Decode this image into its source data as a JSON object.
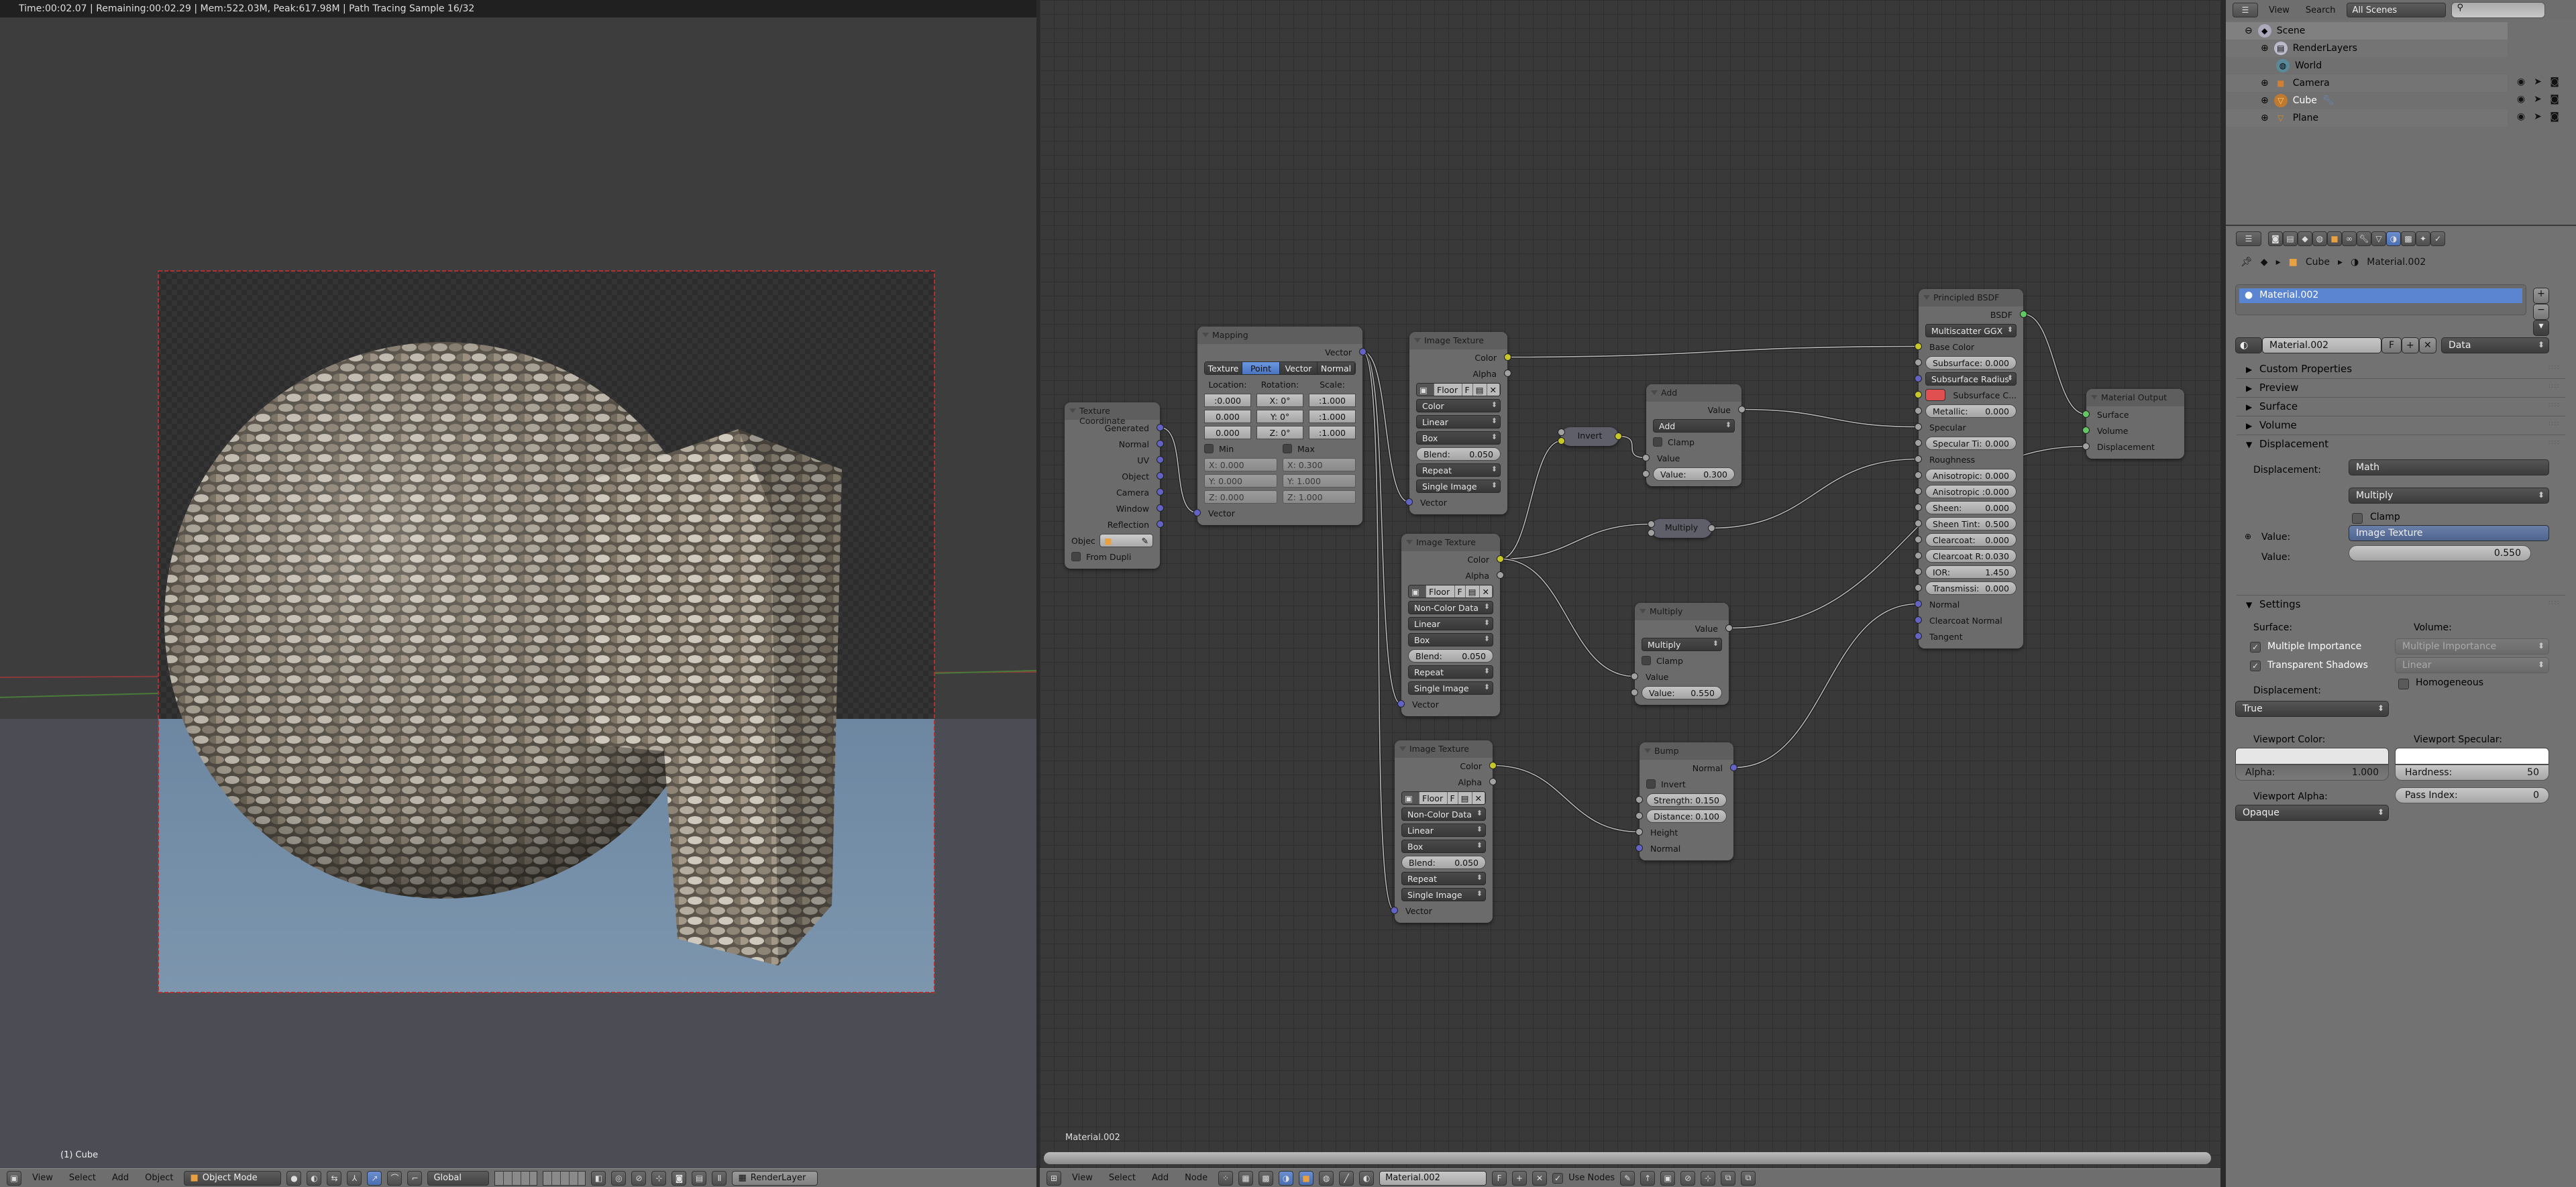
{
  "viewport": {
    "render_info": "Time:00:02.07 | Remaining:00:02.29 | Mem:522.03M, Peak:617.98M | Path Tracing Sample 16/32",
    "object_label": "(1) Cube",
    "header": {
      "menus": [
        "View",
        "Select",
        "Add",
        "Object"
      ],
      "mode": "Object Mode",
      "orientation": "Global",
      "render_layer": "RenderLayer"
    }
  },
  "node_editor": {
    "material_label": "Material.002",
    "header": {
      "menus": [
        "View",
        "Select",
        "Add",
        "Node"
      ],
      "material": "Material.002",
      "fake_user": "F",
      "use_nodes": "Use Nodes"
    },
    "socket_colors": {
      "yellow": "#c7c729",
      "gray": "#a1a1a1",
      "blue": "#6363c7",
      "green": "#63c763"
    },
    "nodes": {
      "texcoord": {
        "title": "Texture Coordinate",
        "rows": [
          {
            "t": "out",
            "label": "Generated",
            "s": "blue"
          },
          {
            "t": "out",
            "label": "Normal",
            "s": "blue"
          },
          {
            "t": "out",
            "label": "UV",
            "s": "blue"
          },
          {
            "t": "out",
            "label": "Object",
            "s": "blue"
          },
          {
            "t": "out",
            "label": "Camera",
            "s": "blue"
          },
          {
            "t": "out",
            "label": "Window",
            "s": "blue"
          },
          {
            "t": "out",
            "label": "Reflection",
            "s": "blue"
          },
          {
            "t": "obj",
            "label": "Objec"
          },
          {
            "t": "chk",
            "label": "From Dupli"
          }
        ]
      },
      "mapping": {
        "title": "Mapping",
        "rows": [
          {
            "t": "out",
            "label": "Vector",
            "s": "blue"
          },
          {
            "t": "tabs",
            "items": [
              "Texture",
              "Point",
              "Vector",
              "Normal"
            ],
            "active": "Point"
          },
          {
            "t": "cols",
            "kind": "label",
            "cells": [
              "Location:",
              "Rotation:",
              "Scale:"
            ]
          },
          {
            "t": "cols",
            "kind": "mini",
            "cells": [
              ":0.000",
              "X:   0°",
              ":1.000"
            ]
          },
          {
            "t": "cols",
            "kind": "mini",
            "cells": [
              "0.000",
              "Y:   0°",
              ":1.000"
            ]
          },
          {
            "t": "cols",
            "kind": "mini",
            "cells": [
              "0.000",
              "Z:   0°",
              ":1.000"
            ]
          },
          {
            "t": "cols",
            "kind": "chk",
            "cells": [
              "Min",
              "Max"
            ]
          },
          {
            "t": "cols",
            "kind": "dis",
            "cells": [
              "X:  0.000",
              "X:  0.300"
            ]
          },
          {
            "t": "cols",
            "kind": "dis",
            "cells": [
              "Y:  0.000",
              "Y:  1.000"
            ]
          },
          {
            "t": "cols",
            "kind": "dis",
            "cells": [
              "Z:  0.000",
              "Z:  1.000"
            ]
          },
          {
            "t": "in",
            "label": "Vector",
            "s": "blue"
          }
        ]
      },
      "img1": {
        "title": "Image Texture",
        "rows": [
          {
            "t": "out",
            "label": "Color",
            "s": "yellow"
          },
          {
            "t": "out",
            "label": "Alpha",
            "s": "gray"
          },
          {
            "t": "img",
            "name": "Floor",
            "f": "F"
          },
          {
            "t": "sel",
            "value": "Color"
          },
          {
            "t": "sel",
            "value": "Linear"
          },
          {
            "t": "sel",
            "value": "Box"
          },
          {
            "t": "num",
            "label": "Blend:",
            "value": "0.050"
          },
          {
            "t": "sel",
            "value": "Repeat"
          },
          {
            "t": "sel",
            "value": "Single Image"
          },
          {
            "t": "in",
            "label": "Vector",
            "s": "blue"
          }
        ]
      },
      "img2": {
        "title": "Image Texture",
        "rows": [
          {
            "t": "out",
            "label": "Color",
            "s": "yellow"
          },
          {
            "t": "out",
            "label": "Alpha",
            "s": "gray"
          },
          {
            "t": "img",
            "name": "Floor",
            "f": "F"
          },
          {
            "t": "sel",
            "value": "Non-Color Data"
          },
          {
            "t": "sel",
            "value": "Linear"
          },
          {
            "t": "sel",
            "value": "Box"
          },
          {
            "t": "num",
            "label": "Blend:",
            "value": "0.050"
          },
          {
            "t": "sel",
            "value": "Repeat"
          },
          {
            "t": "sel",
            "value": "Single Image"
          },
          {
            "t": "in",
            "label": "Vector",
            "s": "blue"
          }
        ]
      },
      "img3": {
        "title": "Image Texture",
        "rows": [
          {
            "t": "out",
            "label": "Color",
            "s": "yellow"
          },
          {
            "t": "out",
            "label": "Alpha",
            "s": "gray"
          },
          {
            "t": "img",
            "name": "Floor",
            "f": "F"
          },
          {
            "t": "sel",
            "value": "Non-Color Data"
          },
          {
            "t": "sel",
            "value": "Linear"
          },
          {
            "t": "sel",
            "value": "Box"
          },
          {
            "t": "num",
            "label": "Blend:",
            "value": "0.050"
          },
          {
            "t": "sel",
            "value": "Repeat"
          },
          {
            "t": "sel",
            "value": "Single Image"
          },
          {
            "t": "in",
            "label": "Vector",
            "s": "blue"
          }
        ]
      },
      "invert": {
        "title": "Invert",
        "collapsed": true,
        "inputs": [
          "gray",
          "yellow"
        ],
        "output": "yellow"
      },
      "mulsmall": {
        "title": "Multiply",
        "collapsed": true,
        "inputs": [
          "gray",
          "gray"
        ],
        "output": "gray"
      },
      "add": {
        "title": "Add",
        "rows": [
          {
            "t": "out",
            "label": "Value",
            "s": "gray"
          },
          {
            "t": "sel",
            "value": "Add"
          },
          {
            "t": "chk",
            "label": "Clamp"
          },
          {
            "t": "in",
            "label": "Value",
            "s": "gray"
          },
          {
            "t": "num",
            "label": "Value:",
            "value": "0.300",
            "s": "gray"
          }
        ]
      },
      "multiply": {
        "title": "Multiply",
        "rows": [
          {
            "t": "out",
            "label": "Value",
            "s": "gray"
          },
          {
            "t": "sel",
            "value": "Multiply"
          },
          {
            "t": "chk",
            "label": "Clamp"
          },
          {
            "t": "in",
            "label": "Value",
            "s": "gray"
          },
          {
            "t": "num",
            "label": "Value:",
            "value": "0.550",
            "s": "gray"
          }
        ]
      },
      "bump": {
        "title": "Bump",
        "rows": [
          {
            "t": "out",
            "label": "Normal",
            "s": "blue"
          },
          {
            "t": "chk",
            "label": "Invert"
          },
          {
            "t": "num",
            "label": "Strength:",
            "value": "0.150",
            "s": "gray"
          },
          {
            "t": "num",
            "label": "Distance:",
            "value": "0.100",
            "s": "gray"
          },
          {
            "t": "in",
            "label": "Height",
            "s": "gray"
          },
          {
            "t": "in",
            "label": "Normal",
            "s": "blue"
          }
        ]
      },
      "principled": {
        "title": "Principled BSDF",
        "rows": [
          {
            "t": "out",
            "label": "BSDF",
            "s": "green"
          },
          {
            "t": "sel",
            "value": "Multiscatter GGX"
          },
          {
            "t": "in",
            "label": "Base Color",
            "s": "yellow"
          },
          {
            "t": "num",
            "label": "Subsurface:",
            "value": "0.000",
            "s": "gray"
          },
          {
            "t": "sel",
            "value": "Subsurface Radius",
            "s": "blue"
          },
          {
            "t": "color",
            "label": "Subsurface C...",
            "s": "yellow",
            "color": "#e05050"
          },
          {
            "t": "num",
            "label": "Metallic:",
            "value": "0.000",
            "s": "gray"
          },
          {
            "t": "in",
            "label": "Specular",
            "s": "gray"
          },
          {
            "t": "num",
            "label": "Specular Ti:",
            "value": "0.000",
            "s": "gray"
          },
          {
            "t": "in",
            "label": "Roughness",
            "s": "gray"
          },
          {
            "t": "num",
            "label": "Anisotropic:",
            "value": "0.000",
            "s": "gray"
          },
          {
            "t": "num",
            "label": "Anisotropic :",
            "value": "0.000",
            "s": "gray"
          },
          {
            "t": "num",
            "label": "Sheen:",
            "value": "0.000",
            "s": "gray"
          },
          {
            "t": "num",
            "label": "Sheen Tint:",
            "value": "0.500",
            "s": "gray"
          },
          {
            "t": "num",
            "label": "Clearcoat:",
            "value": "0.000",
            "s": "gray"
          },
          {
            "t": "num",
            "label": "Clearcoat R:",
            "value": "0.030",
            "s": "gray"
          },
          {
            "t": "num",
            "label": "IOR:",
            "value": "1.450",
            "s": "gray"
          },
          {
            "t": "num",
            "label": "Transmissi:",
            "value": "0.000",
            "s": "gray"
          },
          {
            "t": "in",
            "label": "Normal",
            "s": "blue"
          },
          {
            "t": "in",
            "label": "Clearcoat Normal",
            "s": "blue"
          },
          {
            "t": "in",
            "label": "Tangent",
            "s": "blue"
          }
        ]
      },
      "output": {
        "title": "Material Output",
        "rows": [
          {
            "t": "in",
            "label": "Surface",
            "s": "green"
          },
          {
            "t": "in",
            "label": "Volume",
            "s": "green"
          },
          {
            "t": "in",
            "label": "Displacement",
            "s": "gray"
          }
        ]
      }
    },
    "links": [
      [
        "texcoord",
        "o0",
        "mapping",
        "i0"
      ],
      [
        "mapping",
        "o0",
        "img1",
        "i0"
      ],
      [
        "mapping",
        "o0",
        "img2",
        "i0"
      ],
      [
        "mapping",
        "o0",
        "img3",
        "i0"
      ],
      [
        "img1",
        "o0",
        "principled",
        "i0"
      ],
      [
        "img2",
        "o0",
        "invert",
        "i1"
      ],
      [
        "img2",
        "o0",
        "mulsmall",
        "i0"
      ],
      [
        "img2",
        "o0",
        "multiply",
        "i0"
      ],
      [
        "invert",
        "o0",
        "add",
        "i0"
      ],
      [
        "add",
        "o0",
        "principled",
        "i5"
      ],
      [
        "mulsmall",
        "o0",
        "principled",
        "i7"
      ],
      [
        "multiply",
        "o0",
        "output",
        "i2"
      ],
      [
        "img3",
        "o0",
        "bump",
        "i2"
      ],
      [
        "bump",
        "o0",
        "principled",
        "i16"
      ],
      [
        "principled",
        "o0",
        "output",
        "i0"
      ]
    ]
  },
  "outliner": {
    "menus": [
      "View",
      "Search"
    ],
    "scene_filter": "All Scenes",
    "items": [
      {
        "label": "Scene"
      },
      {
        "label": "RenderLayers"
      },
      {
        "label": "World"
      },
      {
        "label": "Camera"
      },
      {
        "label": "Cube"
      },
      {
        "label": "Plane"
      }
    ]
  },
  "properties": {
    "breadcrumb": [
      "Cube",
      "Material.002"
    ],
    "slot": "Material.002",
    "material_name": "Material.002",
    "fake_user": "F",
    "link": "Data",
    "panels": [
      "Custom Properties",
      "Preview",
      "Surface",
      "Volume",
      "Displacement",
      "Settings"
    ],
    "displacement": {
      "label": "Displacement:",
      "node": "Math",
      "operation": "Multiply",
      "clamp": "Clamp",
      "value_label": "Value:",
      "value_link": "Image Texture",
      "value2_label": "Value:",
      "value2": "0.550"
    },
    "settings": {
      "surface_label": "Surface:",
      "multiple_importance": "Multiple Importance",
      "transparent_shadows": "Transparent Shadows",
      "volume_label": "Volume:",
      "volume_sampling": "Multiple Importance",
      "volume_interp": "Linear",
      "homogeneous": "Homogeneous",
      "displacement_label": "Displacement:",
      "displacement_method": "True",
      "viewport_color_label": "Viewport Color:",
      "alpha_label": "Alpha:",
      "alpha": "1.000",
      "viewport_specular_label": "Viewport Specular:",
      "hardness_label": "Hardness:",
      "hardness": "50",
      "viewport_alpha_label": "Viewport Alpha:",
      "viewport_alpha": "Opaque",
      "pass_index_label": "Pass Index:",
      "pass_index": "0",
      "viewport_color": "#e6e6e6",
      "viewport_specular": "#ffffff"
    }
  }
}
